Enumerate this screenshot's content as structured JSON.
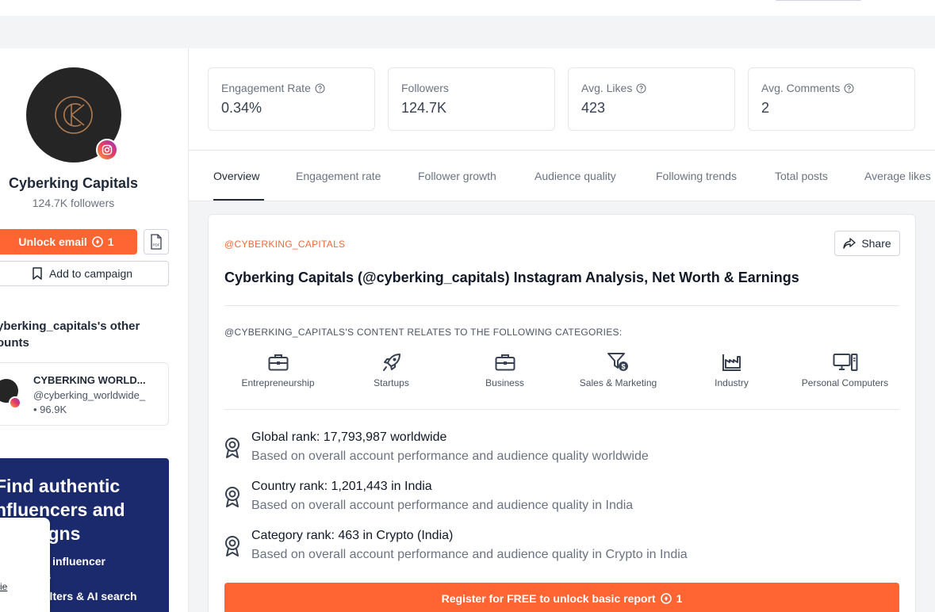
{
  "profile": {
    "name": "Cyberking Capitals",
    "followers": "124.7K followers",
    "unlock_email_label": "Unlock email",
    "unlock_email_cost": "1",
    "add_to_campaign_label": "Add to campaign",
    "pdf_label": "PDF"
  },
  "other_accounts": {
    "title": "yberking_capitals's other ounts",
    "items": [
      {
        "name": "CYBERKING WORLD...",
        "handle": "@cyberking_worldwide_",
        "count": "• 96.9K"
      }
    ]
  },
  "promo": {
    "title": "Find authentic nfluencers and ampaigns",
    "bullet1": "+ influencer",
    "bullet1b": "ts",
    "bullet2": "filters & AI search"
  },
  "cookie": {
    "link": "ie"
  },
  "stats": [
    {
      "label": "Engagement Rate",
      "value": "0.34%"
    },
    {
      "label": "Followers",
      "value": "124.7K"
    },
    {
      "label": "Avg. Likes",
      "value": "423"
    },
    {
      "label": "Avg. Comments",
      "value": "2"
    }
  ],
  "tabs": [
    "Overview",
    "Engagement rate",
    "Follower growth",
    "Audience quality",
    "Following trends",
    "Total posts",
    "Average likes"
  ],
  "report": {
    "handle_label": "@CYBERKING_CAPITALS",
    "share_label": "Share",
    "title": "Cyberking Capitals (@cyberking_capitals) Instagram Analysis, Net Worth & Earnings",
    "categories_heading": "@CYBERKING_CAPITALS'S CONTENT RELATES TO THE FOLLOWING CATEGORIES:",
    "categories": [
      {
        "label": "Entrepreneurship",
        "icon": "briefcase-icon"
      },
      {
        "label": "Startups",
        "icon": "rocket-icon"
      },
      {
        "label": "Business",
        "icon": "briefcase-icon"
      },
      {
        "label": "Sales & Marketing",
        "icon": "funnel-dollar-icon"
      },
      {
        "label": "Industry",
        "icon": "factory-icon"
      },
      {
        "label": "Personal Computers",
        "icon": "computer-icon"
      }
    ],
    "ranks": [
      {
        "title": "Global rank: 17,793,987 worldwide",
        "sub": "Based on overall account performance and audience quality worldwide"
      },
      {
        "title": "Country rank: 1,201,443 in India",
        "sub": "Based on overall account performance and audience quality in India"
      },
      {
        "title": "Category rank: 463 in Crypto (India)",
        "sub": "Based on overall account performance and audience quality in Crypto in India"
      }
    ],
    "register_label": "Register for FREE to unlock basic report",
    "register_cost": "1"
  },
  "colors": {
    "accent": "#ff6433",
    "promo_bg": "#1a2a6c",
    "handle": "#ef6a3a"
  }
}
